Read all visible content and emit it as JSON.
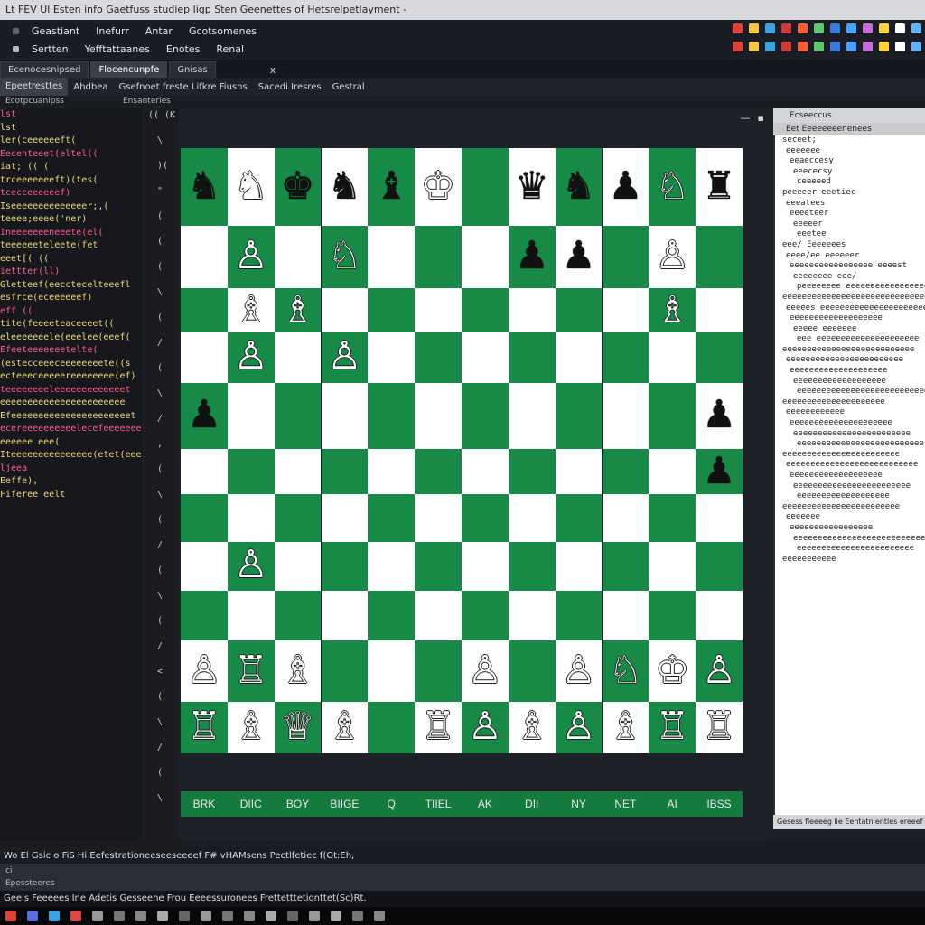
{
  "window": {
    "title": "Lt FEV Ul Esten info Gaetfuss studiep ligp Sten Geenettes of Hetsrelpetlayment -"
  },
  "menubar": {
    "row1": [
      "Geastiant",
      "Inefurr",
      "Antar",
      "Gcotsomenes"
    ],
    "row2": [
      "Sertten",
      "Yefftattaanes",
      "Enotes",
      "Renal"
    ],
    "toolbar_icons": [
      "#e0423a",
      "#f4c542",
      "#3aa3e0",
      "#cc3a3a",
      "#ff5d3a",
      "#62c370",
      "#3a7be0",
      "#4ea0ff",
      "#c46fd6",
      "#ffd43a",
      "#ffffff",
      "#60b3ff"
    ]
  },
  "tabs": [
    {
      "label": "Ecenocesnipsed",
      "active": false
    },
    {
      "label": "Flocencunpfe",
      "active": true
    },
    {
      "label": "Gnisas",
      "active": false
    }
  ],
  "tab_close": "x",
  "subtabs": [
    {
      "label": "Epeetresttes",
      "active": true
    },
    {
      "label": "Ahdbea",
      "active": false
    },
    {
      "label": "Gsefnoet freste Lifkre Fiusns",
      "active": false
    },
    {
      "label": "Sacedi Iresres",
      "active": false
    },
    {
      "label": "Gestral",
      "active": false
    }
  ],
  "subbar": {
    "left": "Ecotpcuanipss",
    "right": "Ensanteries"
  },
  "code_lines": [
    "lst",
    "lst",
    "ler(ceeeeeeft(",
    "Eecenteeet(eltel((",
    "iat;  ((  (",
    "trceeeeeeeft)(tes(",
    "tcecceeeeeef)",
    "Iseeeeeeeeeeeeeer;,(",
    "teeee;eeee('ner)",
    "Ineeeeeeeneeete(el(",
    "teeeeeeteleete(fet",
    "eeet[( ((",
    "iettter(ll)",
    "Gletteef(eecctecelteeefl",
    "esfrce(eceeeeeef)",
    "eff  ((",
    "tite(feeeeteaceeeet((",
    "eleeeeeeele(eeelee(eeef(",
    "Efeeteeeeeeetelte(",
    "(estecceeeceeeeeeeete((s",
    "ecteeeceeeeereeeeeeee(ef)",
    "teeeeeeeeleeeeeeeeeeeeet",
    "eeeeeeeeeeeeeeeeeeeeeee",
    "Efeeeeeeeeeeeeeeeeeeeeeet",
    "ecereeeeeeeeeelecefeeeeeeel",
    "eeeeee eee(",
    "Iteeeeeeeeeeeeeee(etet(eee",
    "ljeea",
    "Eeffe),",
    "Fiferee eelt"
  ],
  "gutter_marks": [
    "(( (K",
    "\\",
    ")(",
    "\"",
    "(",
    "(",
    "(",
    "\\",
    "(",
    "/",
    "(",
    "\\",
    "/",
    ",",
    "(",
    "\\",
    "(",
    "/",
    "(",
    "\\",
    "(",
    "/",
    "<",
    "(",
    "\\",
    "/",
    "(",
    "\\"
  ],
  "panel_controls": [
    "—",
    "▪"
  ],
  "board": {
    "light_color": "#ffffff",
    "dark_color": "#178a47",
    "files": [
      "BRK",
      "DIIC",
      "BOY",
      "BIIGE",
      "Q",
      "TIIEL",
      "AK",
      "DII",
      "NY",
      "NET",
      "AI",
      "IBSS"
    ],
    "rank_row_height_ratios": [
      1.23,
      1,
      0.7,
      0.8,
      1.05,
      0.72,
      0.76,
      0.78,
      0.8,
      0.97,
      0.82
    ],
    "pieces": [
      {
        "row": 0,
        "col": 0,
        "glyph": "♞",
        "color": "b"
      },
      {
        "row": 0,
        "col": 1,
        "glyph": "♞",
        "color": "w"
      },
      {
        "row": 0,
        "col": 2,
        "glyph": "♚",
        "color": "b"
      },
      {
        "row": 0,
        "col": 3,
        "glyph": "♞",
        "color": "b"
      },
      {
        "row": 0,
        "col": 4,
        "glyph": "♝",
        "color": "b"
      },
      {
        "row": 0,
        "col": 5,
        "glyph": "♔",
        "color": "w"
      },
      {
        "row": 0,
        "col": 7,
        "glyph": "♛",
        "color": "b"
      },
      {
        "row": 0,
        "col": 8,
        "glyph": "♞",
        "color": "b"
      },
      {
        "row": 0,
        "col": 9,
        "glyph": "♟",
        "color": "b"
      },
      {
        "row": 0,
        "col": 10,
        "glyph": "♘",
        "color": "w"
      },
      {
        "row": 0,
        "col": 11,
        "glyph": "♜",
        "color": "b"
      },
      {
        "row": 1,
        "col": 1,
        "glyph": "♙",
        "color": "w"
      },
      {
        "row": 1,
        "col": 3,
        "glyph": "♘",
        "color": "w"
      },
      {
        "row": 1,
        "col": 7,
        "glyph": "♟",
        "color": "b"
      },
      {
        "row": 1,
        "col": 8,
        "glyph": "♟",
        "color": "b"
      },
      {
        "row": 1,
        "col": 10,
        "glyph": "♙",
        "color": "w"
      },
      {
        "row": 2,
        "col": 1,
        "glyph": "♗",
        "color": "w"
      },
      {
        "row": 2,
        "col": 2,
        "glyph": "♗",
        "color": "w"
      },
      {
        "row": 2,
        "col": 10,
        "glyph": "♗",
        "color": "w"
      },
      {
        "row": 3,
        "col": 1,
        "glyph": "♙",
        "color": "w"
      },
      {
        "row": 3,
        "col": 3,
        "glyph": "♙",
        "color": "w"
      },
      {
        "row": 4,
        "col": 0,
        "glyph": "♟",
        "color": "b"
      },
      {
        "row": 4,
        "col": 11,
        "glyph": "♟",
        "color": "b"
      },
      {
        "row": 5,
        "col": 11,
        "glyph": "♟",
        "color": "b"
      },
      {
        "row": 7,
        "col": 1,
        "glyph": "♙",
        "color": "w"
      },
      {
        "row": 9,
        "col": 0,
        "glyph": "♙",
        "color": "w"
      },
      {
        "row": 9,
        "col": 1,
        "glyph": "♖",
        "color": "w"
      },
      {
        "row": 9,
        "col": 2,
        "glyph": "♗",
        "color": "w"
      },
      {
        "row": 9,
        "col": 6,
        "glyph": "♙",
        "color": "w"
      },
      {
        "row": 9,
        "col": 8,
        "glyph": "♙",
        "color": "w"
      },
      {
        "row": 9,
        "col": 9,
        "glyph": "♘",
        "color": "w"
      },
      {
        "row": 9,
        "col": 10,
        "glyph": "♔",
        "color": "w"
      },
      {
        "row": 9,
        "col": 11,
        "glyph": "♙",
        "color": "w"
      },
      {
        "row": 10,
        "col": 0,
        "glyph": "♖",
        "color": "w"
      },
      {
        "row": 10,
        "col": 1,
        "glyph": "♗",
        "color": "w"
      },
      {
        "row": 10,
        "col": 2,
        "glyph": "♕",
        "color": "w"
      },
      {
        "row": 10,
        "col": 3,
        "glyph": "♗",
        "color": "w"
      },
      {
        "row": 10,
        "col": 5,
        "glyph": "♖",
        "color": "w"
      },
      {
        "row": 10,
        "col": 6,
        "glyph": "♙",
        "color": "w"
      },
      {
        "row": 10,
        "col": 7,
        "glyph": "♗",
        "color": "w"
      },
      {
        "row": 10,
        "col": 8,
        "glyph": "♙",
        "color": "w"
      },
      {
        "row": 10,
        "col": 9,
        "glyph": "♗",
        "color": "w"
      },
      {
        "row": 10,
        "col": 10,
        "glyph": "♖",
        "color": "w"
      },
      {
        "row": 10,
        "col": 11,
        "glyph": "♖",
        "color": "w"
      }
    ]
  },
  "right_panel": {
    "header": "Ecseeccus",
    "subheader": "Eet Eeeeeeeenenees",
    "lines": [
      "seceet;",
      "eeeeeee",
      "eeaeccesy",
      "eeececsy",
      "ceeeeed",
      "peeeeer eeetiec",
      "eeeatees",
      "eeeeteer",
      "eeeeer",
      "eeetee",
      "eee/ Eeeeeees",
      "eeee/ee eeeeeer",
      "eeeeeeeeeeeeeeeee eeeest",
      "eeeeeeee eee/",
      "peeeeeeee eeeeeeeeeeeeeeeeeeeel,",
      "eeeeeeeeeeeeeeeeeeeeeeeeeeeeeeee",
      "eeeees eeeeeeeeeeeeeeeeeeeeeee",
      "eeeeeeeeeeeeeeeeeee",
      "eeeee eeeeeee",
      "eee eeeeeeeeeeeeeeeeeeeee",
      "eeeeeeeeeeeeeeeeeeeeeeeeeee",
      "eeeeeeeeeeeeeeeeeeeeeeee",
      "eeeeeeeeeeeeeeeeeeee",
      "eeeeeeeeeeeeeeeeeee",
      "eeeeeeeeeeeeeeeeeeeeeeeeeee",
      "eeeeeeeeeeeeeeeeeeeee",
      "eeeeeeeeeeee",
      "eeeeeeeeeeeeeeeeeeeee",
      "eeeeeeeeeeeeeeeeeeeeeeee",
      "eeeeeeeeeeeeeeeeeeeeeeeeee",
      "eeeeeeeeeeeeeeeeeeeeeeee",
      "eeeeeeeeeeeeeeeeeeeeeeeeeee",
      "eeeeeeeeeeeeeeeeeee",
      "eeeeeeeeeeeeeeeeeeeeeeee",
      "eeeeeeeeeeeeeeeeeee",
      "eeeeeeeeeeeeeeeeeeeeeeee",
      "eeeeeee",
      "eeeeeeeeeeeeeeeee",
      "eeeeeeeeeeeeeeeeeeeeeeeeeeee",
      "eeeeeeeeeeeeeeeeeeeeeeee",
      "eeeeeeeeeee"
    ],
    "footer": "Gesess fleeeeg lie Eentatnientles ereeef"
  },
  "bottom": {
    "line1": "Wo El Gsic o FiS Hi Eefestrationeeseeseeeef F# vHAMsens Pectlfetiec f(Gt:Eh,",
    "line2": "ci",
    "line2b": "Epessteeres",
    "line3": "Geeis Feeeees Ine Adetis Gesseene Frou Eeeessuronees Frettetttetionttet(Sc)Rt.",
    "taskbar_icons": [
      "#e0423a",
      "#5f6be0",
      "#3aa3e0",
      "#d84a4a",
      "#999999",
      "#777777",
      "#888888",
      "#aaaaaa",
      "#666666",
      "#999999",
      "#777777",
      "#888888",
      "#aaaaaa",
      "#666666",
      "#999999",
      "#aaaaaa",
      "#777777",
      "#888888"
    ]
  }
}
